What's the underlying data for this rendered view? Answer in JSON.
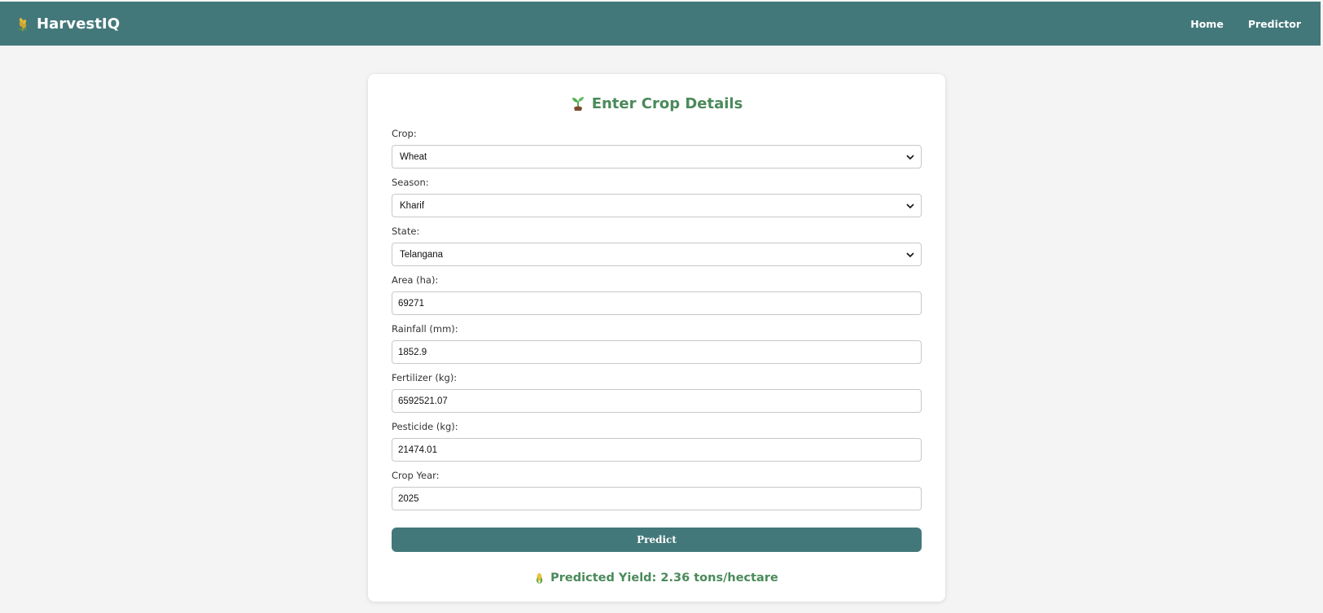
{
  "navbar": {
    "brand_icon": "wheat-icon",
    "brand": "HarvestIQ",
    "links": [
      "Home",
      "Predictor"
    ],
    "background": "#43787a"
  },
  "form": {
    "title_icon": "seedling-icon",
    "title": "Enter Crop Details",
    "crop": {
      "label": "Crop:",
      "value": "Wheat"
    },
    "season": {
      "label": "Season:",
      "value": "Kharif"
    },
    "state": {
      "label": "State:",
      "value": "Telangana"
    },
    "area": {
      "label": "Area (ha):",
      "value": "69271"
    },
    "rainfall": {
      "label": "Rainfall (mm):",
      "value": "1852.9"
    },
    "fertilizer": {
      "label": "Fertilizer (kg):",
      "value": "6592521.07"
    },
    "pesticide": {
      "label": "Pesticide (kg):",
      "value": "21474.01"
    },
    "crop_year": {
      "label": "Crop Year:",
      "value": "2025"
    },
    "predict_label": "Predict"
  },
  "result": {
    "icon": "corn-icon",
    "text": "Predicted Yield: 2.36 tons/hectare",
    "color": "#4a8a5a"
  }
}
